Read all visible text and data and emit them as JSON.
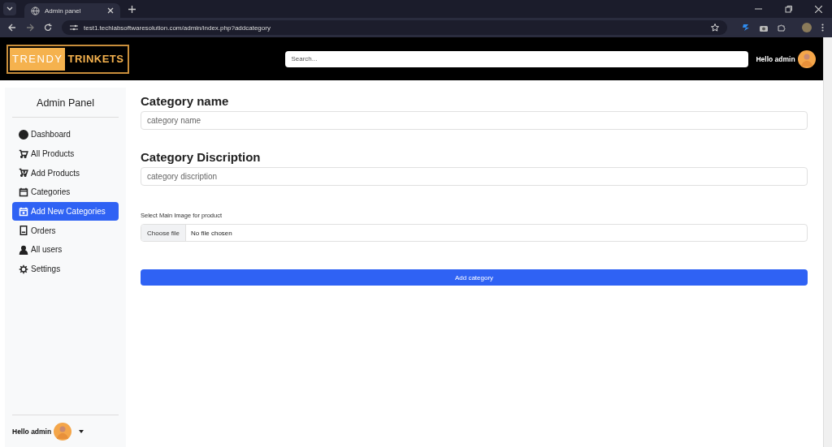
{
  "browser": {
    "tab_title": "Admin panel",
    "url": "test1.techlabsoftwaresolution.com/admin/index.php?addcategory"
  },
  "header": {
    "logo": [
      "TRENDY",
      "TRINKETS"
    ],
    "search": {
      "placeholder": "Search..."
    },
    "greeting": "Hello admin"
  },
  "sidebar": {
    "title": "Admin Panel",
    "items": [
      {
        "label": "Dashboard",
        "selected": false
      },
      {
        "label": "All Products",
        "selected": false
      },
      {
        "label": "Add Products",
        "selected": false
      },
      {
        "label": "Categories",
        "selected": false
      },
      {
        "label": "Add New Categories",
        "selected": true
      },
      {
        "label": "Orders",
        "selected": false
      },
      {
        "label": "All users",
        "selected": false
      },
      {
        "label": "Settings",
        "selected": false
      }
    ],
    "footer_greeting": "Hello admin"
  },
  "form": {
    "name_label": "Category name",
    "name_placeholder": "category name",
    "desc_label": "Category Discription",
    "desc_placeholder": "category discription",
    "image_label": "Select Main Image for product",
    "file_button": "Choose file",
    "file_status": "No file chosen",
    "submit": "Add category"
  }
}
